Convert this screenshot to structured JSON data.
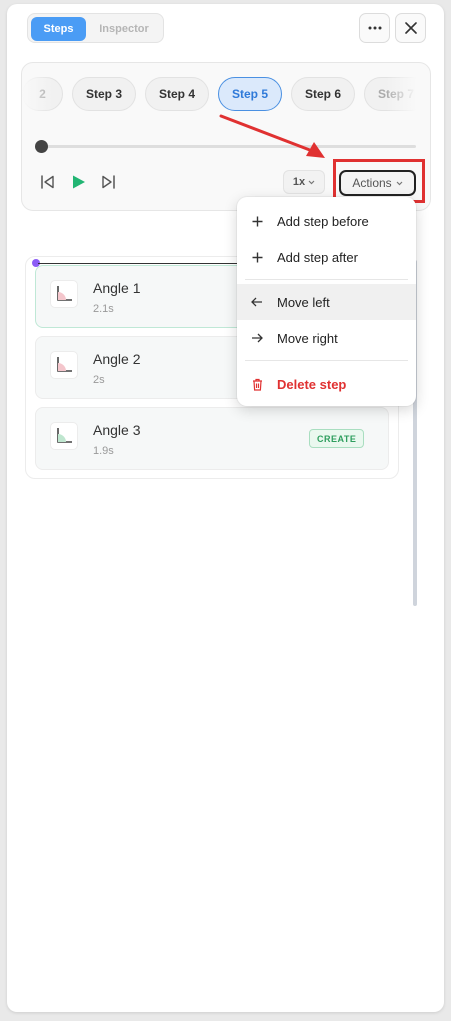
{
  "header": {
    "tabs": [
      {
        "label": "Steps",
        "active": true
      },
      {
        "label": "Inspector",
        "active": false
      }
    ],
    "more_icon": "more-horizontal-icon",
    "close_icon": "close-icon"
  },
  "player": {
    "steps": [
      {
        "label": "2"
      },
      {
        "label": "Step 3"
      },
      {
        "label": "Step 4"
      },
      {
        "label": "Step 5"
      },
      {
        "label": "Step 6"
      },
      {
        "label": "Step 7"
      }
    ],
    "active_step": "Step 5",
    "progress": 0,
    "speed_label": "1x",
    "actions_label": "Actions"
  },
  "menu": {
    "add_before": "Add step before",
    "add_after": "Add step after",
    "move_left": "Move left",
    "move_right": "Move right",
    "delete": "Delete step"
  },
  "items": [
    {
      "name": "Angle 1",
      "duration": "2.1s"
    },
    {
      "name": "Angle 2",
      "duration": "2s"
    },
    {
      "name": "Angle 3",
      "duration": "1.9s",
      "badge": "CREATE"
    }
  ],
  "colors": {
    "accent": "#4a9cf5",
    "play": "#22b573",
    "danger": "#e03131",
    "annotation": "#e03131"
  }
}
